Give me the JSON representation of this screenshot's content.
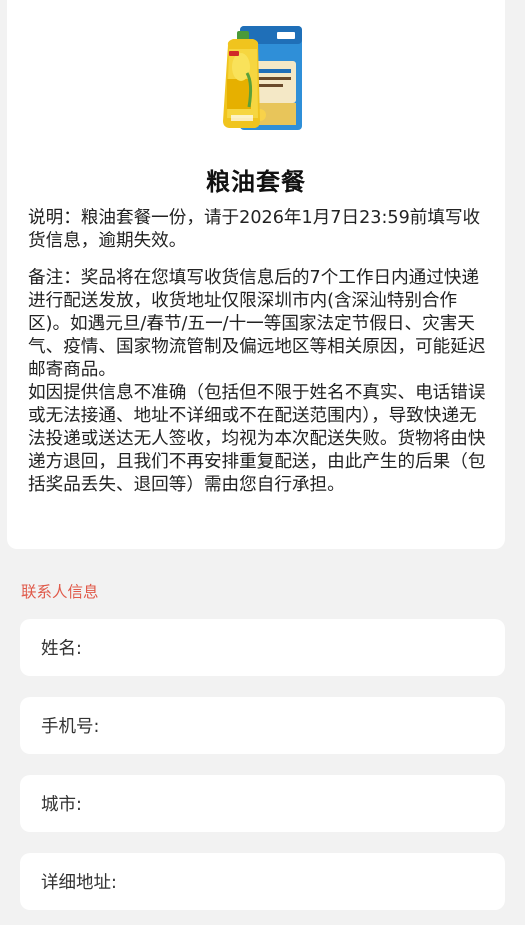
{
  "prize": {
    "image_icon": "grain-and-oil-product-image",
    "title": "粮油套餐",
    "explanation": "说明：粮油套餐一份，请于2026年1月7日23:59前填写收货信息，逾期失效。",
    "remark_1": "备注：奖品将在您填写收货信息后的7个工作日内通过快递进行配送发放，收货地址仅限深圳市内(含深汕特别合作区)。如遇元旦/春节/五一/十一等国家法定节假日、灾害天气、疫情、国家物流管制及偏远地区等相关原因，可能延迟邮寄商品。",
    "remark_2": "如因提供信息不准确（包括但不限于姓名不真实、电话错误或无法接通、地址不详细或不在配送范围内），导致快递无法投递或送达无人签收，均视为本次配送失败。货物将由快递方退回，且我们不再安排重复配送，由此产生的后果（包括奖品丢失、退回等）需由您自行承担。"
  },
  "contact": {
    "section_title": "联系人信息",
    "name_label": "姓名:",
    "name_value": "",
    "phone_label": "手机号:",
    "phone_value": "",
    "city_label": "城市:",
    "city_value": "",
    "address_label": "详细地址:",
    "address_value": ""
  },
  "colors": {
    "section_title": "#e05a4a",
    "page_background": "#f2f2f2",
    "card_background": "#ffffff"
  }
}
